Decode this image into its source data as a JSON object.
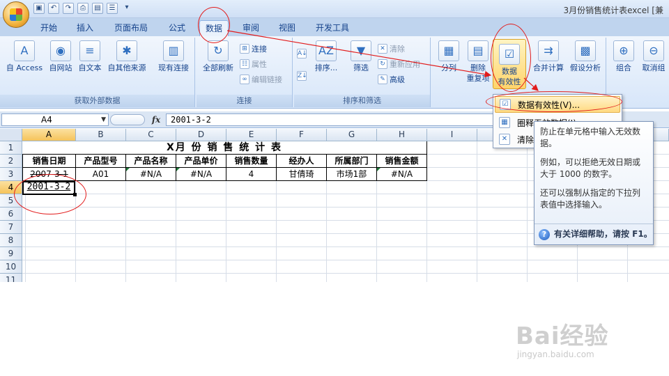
{
  "window": {
    "title": "3月份销售统计表excel [兼"
  },
  "tabs": [
    "开始",
    "插入",
    "页面布局",
    "公式",
    "数据",
    "审阅",
    "视图",
    "开发工具"
  ],
  "active_tab": "数据",
  "ribbon": {
    "groups": {
      "external": "获取外部数据",
      "connections": "连接",
      "sort_filter": "排序和筛选"
    },
    "external": {
      "access": "自 Access",
      "web": "自网站",
      "text": "自文本",
      "other": "自其他来源",
      "existing": "现有连接"
    },
    "connections": {
      "refresh_all": "全部刷新",
      "connect": "连接",
      "properties": "属性",
      "edit_links": "编辑链接"
    },
    "sort_filter": {
      "sort": "排序...",
      "filter": "筛选",
      "clear": "清除",
      "reapply": "重新应用",
      "advanced": "高级"
    },
    "tools": {
      "split": "分列",
      "remove_dup_1": "删除",
      "remove_dup_2": "重复项",
      "validation_1": "数据",
      "validation_2": "有效性",
      "consolidate": "合并计算",
      "whatif": "假设分析",
      "group": "组合",
      "ungroup": "取消组"
    }
  },
  "formula_bar": {
    "cell_ref": "A4",
    "fx": "fx",
    "value": "2001-3-2"
  },
  "columns": [
    "A",
    "B",
    "C",
    "D",
    "E",
    "F",
    "G",
    "H",
    "I"
  ],
  "rows": [
    "1",
    "2",
    "3",
    "4",
    "5",
    "6",
    "7",
    "8",
    "9",
    "10",
    "11"
  ],
  "sheet": {
    "title": "X月 份 销 售 统 计 表",
    "headers": [
      "销售日期",
      "产品型号",
      "产品名称",
      "产品单价",
      "销售数量",
      "经办人",
      "所属部门",
      "销售金额"
    ],
    "row3": [
      "2007-3-1",
      "A01",
      "#N/A",
      "#N/A",
      "4",
      "甘倩琦",
      "市场1部",
      "#N/A"
    ],
    "row4_a": "2001-3-2"
  },
  "dropdown": {
    "item1": "数据有效性(V)...",
    "item2": "圈释无效数据(I)",
    "item3": "清除"
  },
  "tooltip": {
    "p1": "防止在单元格中输入无效数据。",
    "p2": "例如，可以拒绝无效日期或大于 1000 的数字。",
    "p3": "还可以强制从指定的下拉列表值中选择输入。",
    "help": "有关详细帮助，请按 F1。"
  },
  "watermark": {
    "brand": "Bai经验",
    "url": "jingyan.baidu.com"
  }
}
